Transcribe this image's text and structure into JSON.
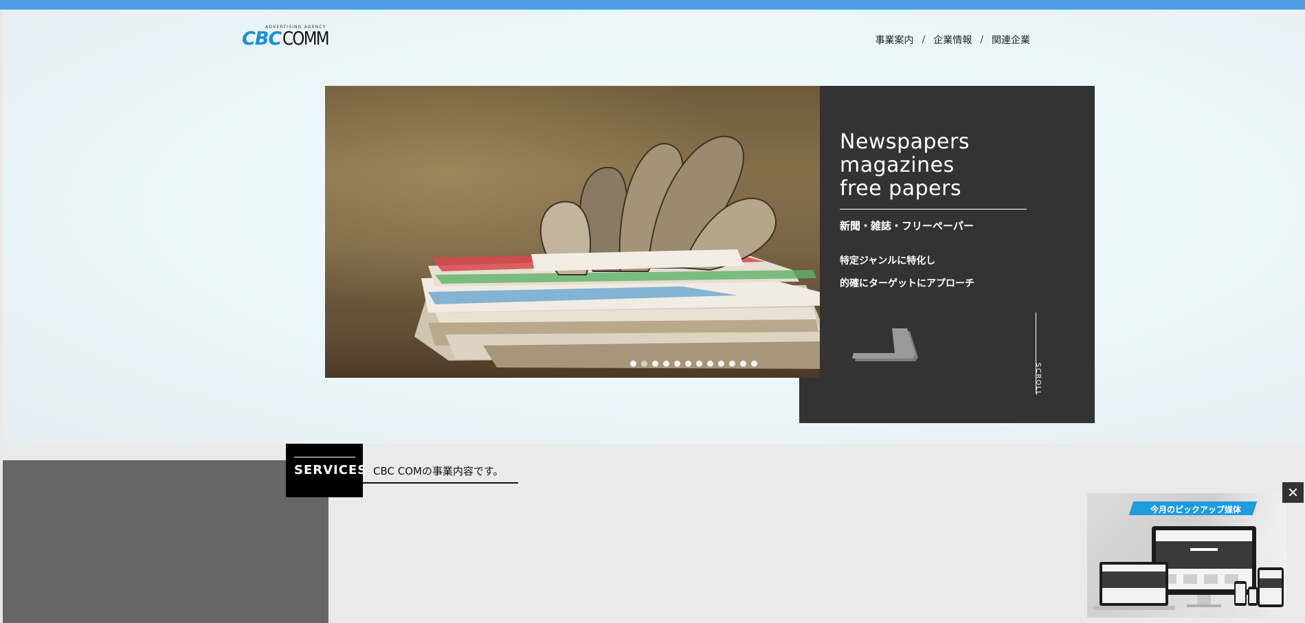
{
  "header": {
    "logo": {
      "sub": "ADVERTISING  AGENCY",
      "cbc": "CBC",
      "comm": "COMM"
    },
    "nav": {
      "items": [
        {
          "label": "事業案内"
        },
        {
          "label": "企業情報"
        },
        {
          "label": "関連企業"
        }
      ],
      "separator": "/"
    }
  },
  "hero": {
    "title_lines": [
      "Newspapers",
      "magazines",
      "free papers"
    ],
    "subtitle": "新聞・雑誌・フリーペーパー",
    "description_lines": [
      "特定ジャンルに特化し",
      "的確にターゲットにアプローチ"
    ],
    "scroll_label": "SCROLL",
    "slide_count": 12,
    "active_slide": 1
  },
  "services": {
    "badge": "SERVICES",
    "caption": "CBC COMの事業内容です。"
  },
  "popup": {
    "banner": "今月のピックアップ媒体",
    "close_label": "✕"
  },
  "colors": {
    "top_bar": "#4d9ee2",
    "panel": "#333333",
    "accent_blue": "#1f9be0",
    "logo_blue": "#1c8fd6"
  }
}
